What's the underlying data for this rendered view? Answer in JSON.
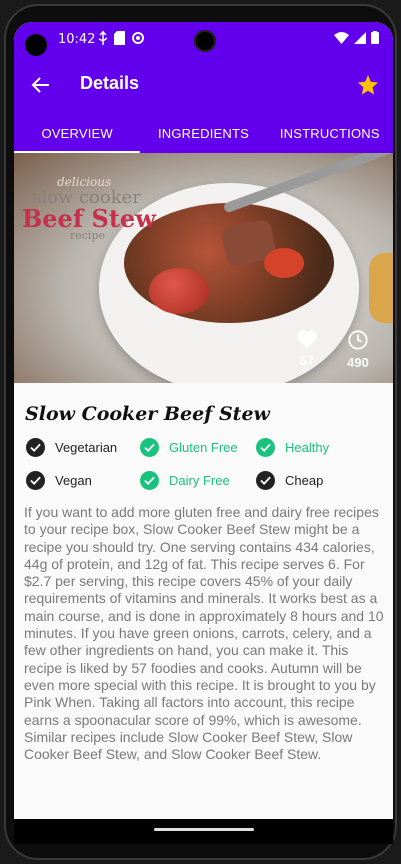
{
  "status_bar": {
    "time": "10:42"
  },
  "app_bar": {
    "title": "Details"
  },
  "tabs": [
    {
      "label": "OVERVIEW",
      "active": true
    },
    {
      "label": "INGREDIENTS",
      "active": false
    },
    {
      "label": "INSTRUCTIONS",
      "active": false
    }
  ],
  "hero": {
    "image_text": {
      "line1": "delicious",
      "line2": "slow cooker",
      "line3": "Beef Stew",
      "line4": "recipe"
    },
    "likes": "57",
    "minutes": "490"
  },
  "recipe": {
    "title": "Slow Cooker Beef Stew",
    "tags": [
      {
        "label": "Vegetarian",
        "on": false
      },
      {
        "label": "Gluten Free",
        "on": true
      },
      {
        "label": "Healthy",
        "on": true
      },
      {
        "label": "Vegan",
        "on": false
      },
      {
        "label": "Dairy Free",
        "on": true
      },
      {
        "label": "Cheap",
        "on": false
      }
    ],
    "summary": "If you want to add more gluten free and dairy free recipes to your recipe box, Slow Cooker Beef Stew might be a recipe you should try. One serving contains 434 calories, 44g of protein, and 12g of fat. This recipe serves 6. For $2.7 per serving, this recipe covers 45% of your daily requirements of vitamins and minerals. It works best as a main course, and is done in approximately 8 hours and 10 minutes. If you have green onions, carrots, celery, and a few other ingredients on hand, you can make it. This recipe is liked by 57 foodies and cooks. Autumn will be even more special with this recipe. It is brought to you by Pink When. Taking all factors into account, this recipe earns a spoonacular score of 99%, which is awesome. Similar recipes include Slow Cooker Beef Stew, Slow Cooker Beef Stew, and Slow Cooker Beef Stew."
  },
  "colors": {
    "primary": "#6200ee",
    "accent_star": "#ffc107",
    "tag_on": "#19c37d",
    "tag_off": "#222222"
  },
  "icons": {
    "back": "arrow-left-icon",
    "favorite": "star-icon",
    "likes": "heart-icon",
    "time": "clock-icon",
    "check": "check-circle-icon"
  }
}
